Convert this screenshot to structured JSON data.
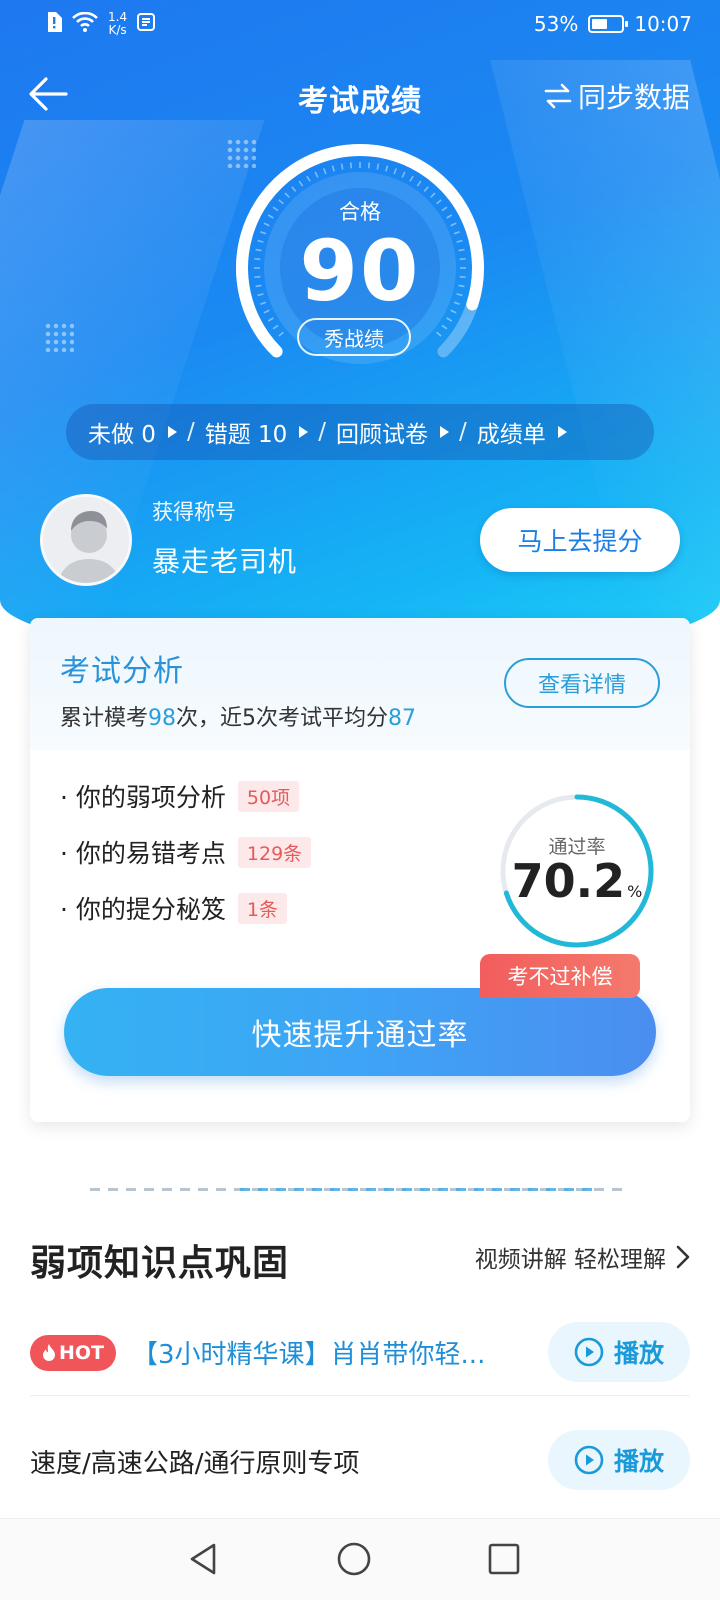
{
  "status_bar": {
    "net_speed_value": "1.4",
    "net_speed_unit": "K/s",
    "battery": "53%",
    "battery_level": 0.53,
    "time": "10:07",
    "icons": [
      "sim-alert-icon",
      "wifi-icon",
      "net-speed",
      "app-notification-icon",
      "battery-icon"
    ]
  },
  "nav": {
    "title": "考试成绩",
    "sync_label": "同步数据",
    "icons": [
      "back-arrow-icon",
      "sync-arrows-icon"
    ]
  },
  "score": {
    "status": "合格",
    "value": "90",
    "gauge_fraction": 0.9,
    "show_button": "秀战绩"
  },
  "quick_links": [
    {
      "label": "未做 0"
    },
    {
      "label": "错题 10"
    },
    {
      "label": "回顾试卷"
    },
    {
      "label": "成绩单"
    }
  ],
  "title_info": {
    "caption": "获得称号",
    "name": "暴走老司机",
    "boost_button": "马上去提分"
  },
  "analysis": {
    "title": "考试分析",
    "detail_button": "查看详情",
    "summary": {
      "prefix": "累计模考",
      "count": "98",
      "middle": "次，近5次考试平均分",
      "avg": "87"
    },
    "items": [
      {
        "label": "· 你的弱项分析",
        "badge": "50项"
      },
      {
        "label": "· 你的易错考点",
        "badge": "129条"
      },
      {
        "label": "· 你的提分秘笈",
        "badge": "1条"
      }
    ],
    "pass_rate": {
      "label": "通过率",
      "value": "70.2",
      "unit": "%",
      "fraction": 0.702
    },
    "main_button": "快速提升通过率",
    "compensation_tag": "考不过补偿"
  },
  "weak_section": {
    "title": "弱项知识点巩固",
    "more": "视频讲解 轻松理解",
    "courses": [
      {
        "hot": "HOT",
        "title": "【3小时精华课】肖肖带你轻...",
        "play": "播放"
      },
      {
        "title": "速度/高速公路/通行原则专项",
        "play": "播放"
      }
    ]
  },
  "colors": {
    "brand_blue": "#1a8af2",
    "accent_cyan": "#2a9ed8",
    "badge_red": "#e55a5a",
    "hot_red": "#f0555a"
  }
}
